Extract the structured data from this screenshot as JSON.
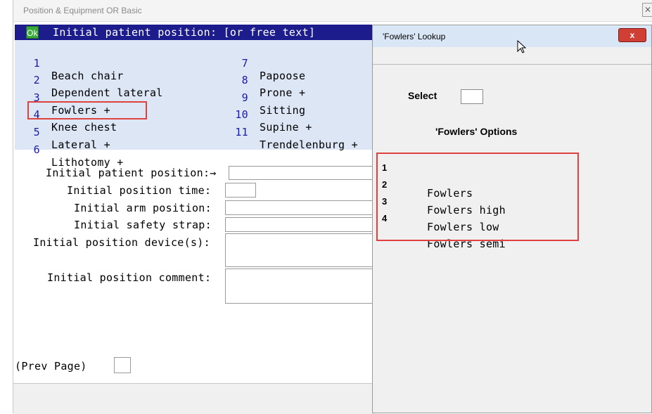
{
  "window": {
    "title": "Position & Equipment OR Basic",
    "close_glyph": "⨯"
  },
  "list": {
    "ok_label": "Ok",
    "header": "Initial patient position: [or free text]",
    "options": [
      {
        "num": "1",
        "label": "Beach chair"
      },
      {
        "num": "2",
        "label": "Dependent lateral"
      },
      {
        "num": "3",
        "label": "Fowlers +"
      },
      {
        "num": "4",
        "label": "Knee chest"
      },
      {
        "num": "5",
        "label": "Lateral +"
      },
      {
        "num": "6",
        "label": "Lithotomy +"
      },
      {
        "num": "7",
        "label": "Papoose"
      },
      {
        "num": "8",
        "label": "Prone +"
      },
      {
        "num": "9",
        "label": "Sitting"
      },
      {
        "num": "10",
        "label": "Supine +"
      },
      {
        "num": "11",
        "label": "Trendelenburg +"
      }
    ]
  },
  "form": {
    "patient_position_label": "Initial patient position:→",
    "position_time_label": "Initial position time:",
    "arm_position_label": "Initial arm position:",
    "safety_strap_label": "Initial safety strap:",
    "position_devices_label": "Initial position device(s):",
    "position_comment_label": "Initial position comment:",
    "prev_page_label": "(Prev Page)"
  },
  "lookup": {
    "title": "'Fowlers' Lookup",
    "close_glyph": "x",
    "select_label": "Select",
    "options_heading": "'Fowlers' Options",
    "options": [
      {
        "num": "1",
        "label": "Fowlers"
      },
      {
        "num": "2",
        "label": "Fowlers high"
      },
      {
        "num": "3",
        "label": "Fowlers low"
      },
      {
        "num": "4",
        "label": "Fowlers semi"
      }
    ]
  },
  "colors": {
    "header_bg": "#1c1c8c",
    "list_bg": "#dce6f5",
    "number_blue": "#1a1aa8",
    "ok_green": "#3aa83a",
    "highlight_red": "#e0413e",
    "dialog_close_red": "#cf3f33"
  }
}
